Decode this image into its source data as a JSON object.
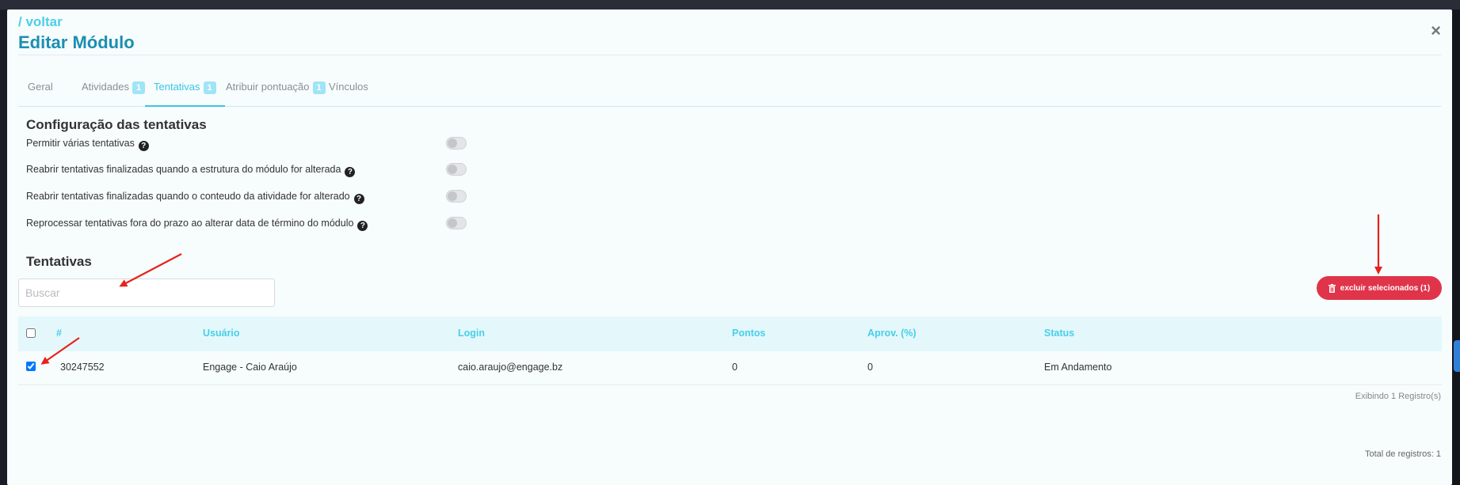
{
  "header": {
    "back_label": "/ voltar",
    "title": "Editar Módulo",
    "close_glyph": "×"
  },
  "tabs": [
    {
      "label": "Geral",
      "badge": "",
      "active": false
    },
    {
      "label": "Atividades",
      "badge": "1",
      "active": false
    },
    {
      "label": "Tentativas",
      "badge": "1",
      "active": true
    },
    {
      "label": "Atribuir pontuação",
      "badge": "1",
      "active": false
    },
    {
      "label": "Vínculos",
      "badge": "",
      "active": false
    }
  ],
  "config": {
    "title": "Configuração das tentativas",
    "options": [
      {
        "label": "Permitir várias tentativas",
        "enabled": false
      },
      {
        "label": "Reabrir tentativas finalizadas quando a estrutura do módulo for alterada",
        "enabled": false
      },
      {
        "label": "Reabrir tentativas finalizadas quando o conteudo da atividade for alterado",
        "enabled": false
      },
      {
        "label": "Reprocessar tentativas fora do prazo ao alterar data de término do módulo",
        "enabled": false
      }
    ]
  },
  "attempts": {
    "title": "Tentativas",
    "search_placeholder": "Buscar",
    "delete_label": "excluir selecionados (1)",
    "columns": [
      "#",
      "Usuário",
      "Login",
      "Pontos",
      "Aprov. (%)",
      "Status"
    ],
    "rows": [
      {
        "selected": true,
        "id": "30247552",
        "user": "Engage - Caio Araújo",
        "login": "caio.araujo@engage.bz",
        "points": "0",
        "approval": "0",
        "status": "Em Andamento"
      }
    ],
    "showing": "Exibindo 1 Registro(s)",
    "total": "Total de registros: 1"
  },
  "icons": {
    "close": "close-icon",
    "help": "help-circle-icon",
    "trash": "trash-icon"
  },
  "colors": {
    "accent": "#39c7e6",
    "title": "#1b8fb1",
    "danger": "#e0344a",
    "annotation": "#e8221c"
  }
}
